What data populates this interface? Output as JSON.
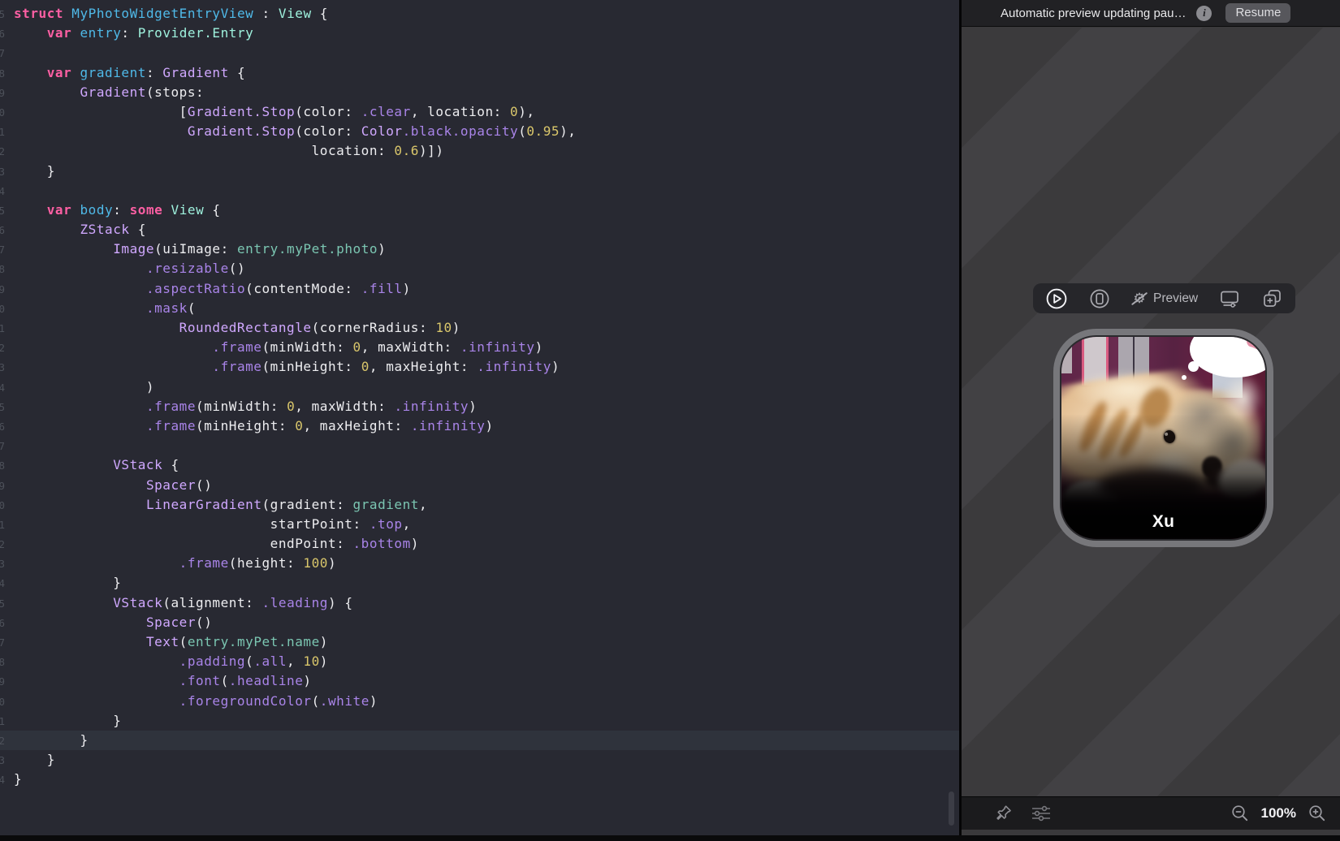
{
  "colors": {
    "editor_bg": "#282932",
    "current_line": "#2F333C",
    "keyword": "#FC5FA3",
    "declaration": "#4FB9E8",
    "project_type": "#9EF1DD",
    "sdk_class": "#D0A8FF",
    "member": "#A984E8",
    "plain": "#EDEDF0",
    "number": "#D9C66B",
    "project_property": "#7BC6B2",
    "canvas_stripe_dark": "#3B3A3C",
    "canvas_stripe_light": "#424144",
    "panel_header_bg": "#212124"
  },
  "editor": {
    "highlighted_line_index": 37,
    "lines": [
      [
        [
          "k",
          "struct"
        ],
        [
          "p",
          " "
        ],
        [
          "d",
          "MyPhotoWidgetEntryView"
        ],
        [
          "p",
          " : "
        ],
        [
          "t",
          "View"
        ],
        [
          "p",
          " {"
        ]
      ],
      [
        [
          "p",
          "    "
        ],
        [
          "k",
          "var"
        ],
        [
          "p",
          " "
        ],
        [
          "d",
          "entry"
        ],
        [
          "p",
          ": "
        ],
        [
          "t",
          "Provider.Entry"
        ]
      ],
      [],
      [
        [
          "p",
          "    "
        ],
        [
          "k",
          "var"
        ],
        [
          "p",
          " "
        ],
        [
          "d",
          "gradient"
        ],
        [
          "p",
          ": "
        ],
        [
          "c",
          "Gradient"
        ],
        [
          "p",
          " {"
        ]
      ],
      [
        [
          "p",
          "        "
        ],
        [
          "c",
          "Gradient"
        ],
        [
          "p",
          "(stops:"
        ]
      ],
      [
        [
          "p",
          "                    ["
        ],
        [
          "c",
          "Gradient.Stop"
        ],
        [
          "p",
          "(color: "
        ],
        [
          "m",
          ".clear"
        ],
        [
          "p",
          ", location: "
        ],
        [
          "n",
          "0"
        ],
        [
          "p",
          "),"
        ]
      ],
      [
        [
          "p",
          "                     "
        ],
        [
          "c",
          "Gradient.Stop"
        ],
        [
          "p",
          "(color: "
        ],
        [
          "c",
          "Color"
        ],
        [
          "m",
          ".black.opacity"
        ],
        [
          "p",
          "("
        ],
        [
          "n",
          "0.95"
        ],
        [
          "p",
          "),"
        ]
      ],
      [
        [
          "p",
          "                                    location: "
        ],
        [
          "n",
          "0.6"
        ],
        [
          "p",
          ")])"
        ]
      ],
      [
        [
          "p",
          "    }"
        ]
      ],
      [],
      [
        [
          "p",
          "    "
        ],
        [
          "k",
          "var"
        ],
        [
          "p",
          " "
        ],
        [
          "d",
          "body"
        ],
        [
          "p",
          ": "
        ],
        [
          "k",
          "some"
        ],
        [
          "p",
          " "
        ],
        [
          "t",
          "View"
        ],
        [
          "p",
          " {"
        ]
      ],
      [
        [
          "p",
          "        "
        ],
        [
          "c",
          "ZStack"
        ],
        [
          "p",
          " {"
        ]
      ],
      [
        [
          "p",
          "            "
        ],
        [
          "c",
          "Image"
        ],
        [
          "p",
          "(uiImage: "
        ],
        [
          "r",
          "entry.myPet.photo"
        ],
        [
          "p",
          ")"
        ]
      ],
      [
        [
          "p",
          "                "
        ],
        [
          "m",
          ".resizable"
        ],
        [
          "p",
          "()"
        ]
      ],
      [
        [
          "p",
          "                "
        ],
        [
          "m",
          ".aspectRatio"
        ],
        [
          "p",
          "(contentMode: "
        ],
        [
          "m",
          ".fill"
        ],
        [
          "p",
          ")"
        ]
      ],
      [
        [
          "p",
          "                "
        ],
        [
          "m",
          ".mask"
        ],
        [
          "p",
          "("
        ]
      ],
      [
        [
          "p",
          "                    "
        ],
        [
          "c",
          "RoundedRectangle"
        ],
        [
          "p",
          "(cornerRadius: "
        ],
        [
          "n",
          "10"
        ],
        [
          "p",
          ")"
        ]
      ],
      [
        [
          "p",
          "                        "
        ],
        [
          "m",
          ".frame"
        ],
        [
          "p",
          "(minWidth: "
        ],
        [
          "n",
          "0"
        ],
        [
          "p",
          ", maxWidth: "
        ],
        [
          "m",
          ".infinity"
        ],
        [
          "p",
          ")"
        ]
      ],
      [
        [
          "p",
          "                        "
        ],
        [
          "m",
          ".frame"
        ],
        [
          "p",
          "(minHeight: "
        ],
        [
          "n",
          "0"
        ],
        [
          "p",
          ", maxHeight: "
        ],
        [
          "m",
          ".infinity"
        ],
        [
          "p",
          ")"
        ]
      ],
      [
        [
          "p",
          "                )"
        ]
      ],
      [
        [
          "p",
          "                "
        ],
        [
          "m",
          ".frame"
        ],
        [
          "p",
          "(minWidth: "
        ],
        [
          "n",
          "0"
        ],
        [
          "p",
          ", maxWidth: "
        ],
        [
          "m",
          ".infinity"
        ],
        [
          "p",
          ")"
        ]
      ],
      [
        [
          "p",
          "                "
        ],
        [
          "m",
          ".frame"
        ],
        [
          "p",
          "(minHeight: "
        ],
        [
          "n",
          "0"
        ],
        [
          "p",
          ", maxHeight: "
        ],
        [
          "m",
          ".infinity"
        ],
        [
          "p",
          ")"
        ]
      ],
      [],
      [
        [
          "p",
          "            "
        ],
        [
          "c",
          "VStack"
        ],
        [
          "p",
          " {"
        ]
      ],
      [
        [
          "p",
          "                "
        ],
        [
          "c",
          "Spacer"
        ],
        [
          "p",
          "()"
        ]
      ],
      [
        [
          "p",
          "                "
        ],
        [
          "c",
          "LinearGradient"
        ],
        [
          "p",
          "(gradient: "
        ],
        [
          "r",
          "gradient"
        ],
        [
          "p",
          ","
        ]
      ],
      [
        [
          "p",
          "                               startPoint: "
        ],
        [
          "m",
          ".top"
        ],
        [
          "p",
          ","
        ]
      ],
      [
        [
          "p",
          "                               endPoint: "
        ],
        [
          "m",
          ".bottom"
        ],
        [
          "p",
          ")"
        ]
      ],
      [
        [
          "p",
          "                    "
        ],
        [
          "m",
          ".frame"
        ],
        [
          "p",
          "(height: "
        ],
        [
          "n",
          "100"
        ],
        [
          "p",
          ")"
        ]
      ],
      [
        [
          "p",
          "            }"
        ]
      ],
      [
        [
          "p",
          "            "
        ],
        [
          "c",
          "VStack"
        ],
        [
          "p",
          "(alignment: "
        ],
        [
          "m",
          ".leading"
        ],
        [
          "p",
          ") {"
        ]
      ],
      [
        [
          "p",
          "                "
        ],
        [
          "c",
          "Spacer"
        ],
        [
          "p",
          "()"
        ]
      ],
      [
        [
          "p",
          "                "
        ],
        [
          "c",
          "Text"
        ],
        [
          "p",
          "("
        ],
        [
          "r",
          "entry.myPet.name"
        ],
        [
          "p",
          ")"
        ]
      ],
      [
        [
          "p",
          "                    "
        ],
        [
          "m",
          ".padding"
        ],
        [
          "p",
          "("
        ],
        [
          "m",
          ".all"
        ],
        [
          "p",
          ", "
        ],
        [
          "n",
          "10"
        ],
        [
          "p",
          ")"
        ]
      ],
      [
        [
          "p",
          "                    "
        ],
        [
          "m",
          ".font"
        ],
        [
          "p",
          "("
        ],
        [
          "m",
          ".headline"
        ],
        [
          "p",
          ")"
        ]
      ],
      [
        [
          "p",
          "                    "
        ],
        [
          "m",
          ".foregroundColor"
        ],
        [
          "p",
          "("
        ],
        [
          "m",
          ".white"
        ],
        [
          "p",
          ")"
        ]
      ],
      [
        [
          "p",
          "            }"
        ]
      ],
      [
        [
          "p",
          "        }"
        ]
      ],
      [
        [
          "p",
          "    }"
        ]
      ],
      [
        [
          "p",
          "}"
        ]
      ]
    ]
  },
  "panel": {
    "header": {
      "message": "Automatic preview updating pau…",
      "info_icon": "info-circle-icon",
      "resume_label": "Resume"
    },
    "toolbar": {
      "icons": [
        "play-circle",
        "device-preview",
        "selectable-disabled-gear",
        "display",
        "duplicate-preview"
      ],
      "gear_glyph": "⚙",
      "preview_label": "Preview"
    },
    "preview": {
      "widget_name": "Xu"
    },
    "statusbar": {
      "icons": [
        "pin",
        "preview-options-sliders",
        "zoom-out-magnifier",
        "zoom-in-magnifier"
      ],
      "zoom_level": "100%"
    }
  }
}
